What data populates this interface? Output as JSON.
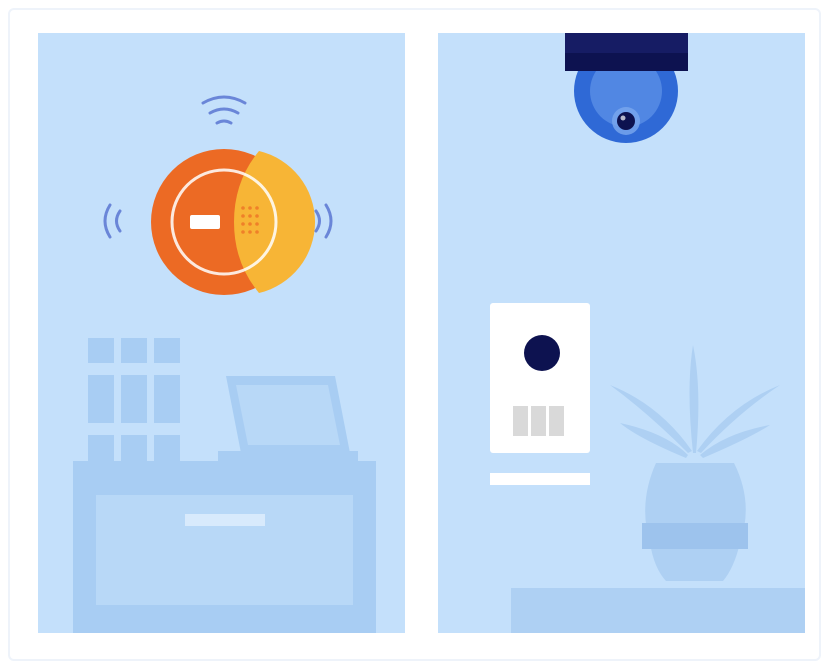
{
  "scene": {
    "left_panel": {
      "device": "smart-smoke-alarm-icon",
      "signals": [
        "wifi-icon",
        "wave-left-icon",
        "wave-right-icon"
      ],
      "furniture": [
        "binders-icon",
        "laptop-icon",
        "desk-icon"
      ]
    },
    "right_panel": {
      "devices": [
        "dome-camera-icon",
        "video-doorbell-icon"
      ],
      "decor": [
        "potted-plant-icon",
        "shelf-icon"
      ]
    }
  },
  "colors": {
    "background": "#ffffff",
    "panel": "#c4e0fb",
    "furniture": "#a8cdf3",
    "alarm_orange": "#ec6a24",
    "alarm_yellow": "#f7b536",
    "camera_navy": "#0d1250",
    "camera_blue": "#2f69d6",
    "signal": "#6a86d8"
  }
}
